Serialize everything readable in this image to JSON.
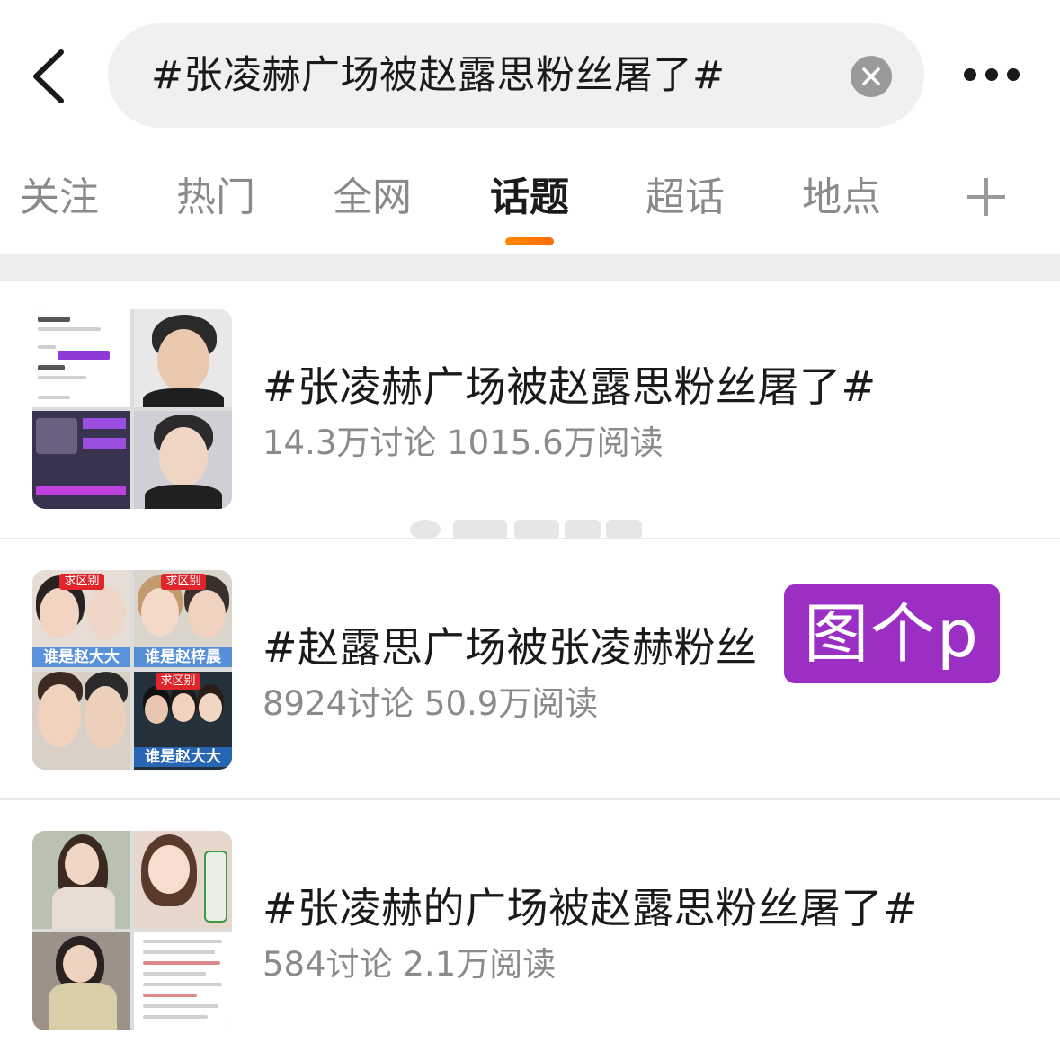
{
  "search": {
    "query": "#张凌赫广场被赵露思粉丝屠了#"
  },
  "icons": {
    "back": "chevron-left-icon",
    "clear": "close-circle-icon",
    "more": "more-horizontal-icon",
    "add_tab": "plus-icon"
  },
  "tabs": [
    {
      "label": "关注"
    },
    {
      "label": "热门"
    },
    {
      "label": "全网"
    },
    {
      "label": "话题",
      "active": true
    },
    {
      "label": "超话"
    },
    {
      "label": "地点"
    }
  ],
  "colors": {
    "accent": "#ff7a00",
    "overlay": "#9b2fc4",
    "muted_text": "#8a8a8a"
  },
  "results": [
    {
      "title": "#张凌赫广场被赵露思粉丝屠了#",
      "stats": "14.3万讨论 1015.6万阅读"
    },
    {
      "title": "#赵露思广场被张凌赫粉丝",
      "stats": "8924讨论 50.9万阅读",
      "thumb_captions": [
        "求区别",
        "求区别",
        "谁是赵大大",
        "谁是赵梓晨",
        "求区别",
        "谁是赵大大"
      ]
    },
    {
      "title": "#张凌赫的广场被赵露思粉丝屠了#",
      "stats": "584讨论 2.1万阅读"
    }
  ],
  "overlay_badge": "图个p"
}
